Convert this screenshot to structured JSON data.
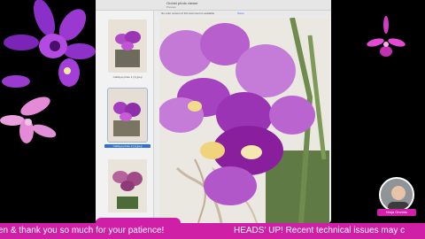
{
  "window": {
    "title": "Orchid photo viewer",
    "subtitle": "Preview",
    "info_text": "No color version of this document is available",
    "info_action": "Show",
    "thumbnails": [
      {
        "label": ""
      },
      {
        "label": "Cattleya photo 1 (1).jpeg"
      },
      {
        "label": "Cattleya photo 2 (1).jpeg"
      }
    ]
  },
  "presenter": {
    "name": "Ninja Orchids"
  },
  "ticker": {
    "text_1": "en & thank you so much for your patience!",
    "text_2": "HEADS' UP! Recent technical issues may c"
  },
  "colors": {
    "ticker": "#cf1fa6",
    "orchid": "#b03ac9",
    "background": "#000000"
  }
}
